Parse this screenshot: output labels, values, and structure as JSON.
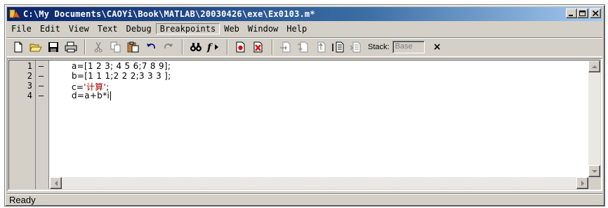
{
  "window": {
    "title": "C:\\My Documents\\CAOYi\\Book\\MATLAB\\20030426\\exe\\Ex0103.m*"
  },
  "title_buttons": {
    "minimize": "_",
    "maximize": "□",
    "close": "×"
  },
  "menu": {
    "items": [
      {
        "label": "File"
      },
      {
        "label": "Edit"
      },
      {
        "label": "View"
      },
      {
        "label": "Text"
      },
      {
        "label": "Debug"
      },
      {
        "label": "Breakpoints",
        "active": true
      },
      {
        "label": "Web"
      },
      {
        "label": "Window"
      },
      {
        "label": "Help"
      }
    ]
  },
  "toolbar": {
    "icons": [
      "new-file-icon",
      "open-folder-icon",
      "save-icon",
      "print-icon",
      "cut-icon",
      "copy-icon",
      "paste-icon",
      "undo-icon",
      "redo-icon",
      "find-icon",
      "function-icon",
      "set-breakpoint-icon",
      "clear-breakpoints-icon",
      "step-icon",
      "step-in-icon",
      "step-out-icon",
      "continue-icon",
      "exit-debug-icon"
    ],
    "stack_label": "Stack:",
    "stack_value": "Base",
    "close_label": "×"
  },
  "editor": {
    "lines": [
      {
        "number": "1",
        "marker": "—",
        "code": "a=[1 2 3; 4 5 6;7 8 9];"
      },
      {
        "number": "2",
        "marker": "—",
        "code": "b=[1 1 1;2 2 2;3 3 3 ];"
      },
      {
        "number": "3",
        "marker": "—",
        "code_prefix": "c=",
        "code_string": "'计算'",
        "code_suffix": ";"
      },
      {
        "number": "4",
        "marker": "—",
        "code": "d=a+b*i"
      }
    ]
  },
  "status": {
    "text": "Ready"
  },
  "colors": {
    "titlebar_start": "#0a246a",
    "titlebar_end": "#a6caf0",
    "chrome": "#d4d0c8",
    "string": "#a00000"
  }
}
